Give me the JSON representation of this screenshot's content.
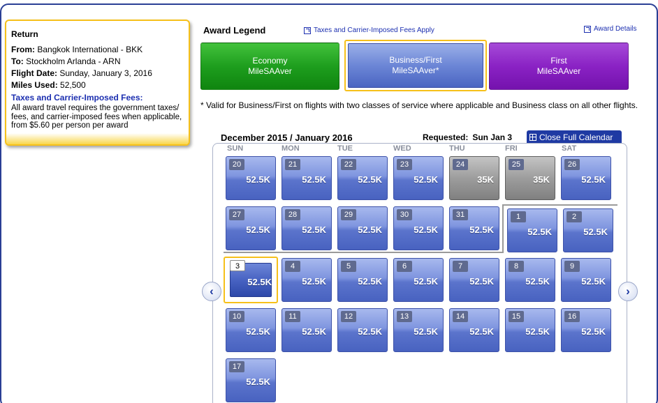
{
  "return_box": {
    "title": "Return",
    "from_label": "From:",
    "from_value": "Bangkok International - BKK",
    "to_label": "To:",
    "to_value": "Stockholm Arlanda - ARN",
    "date_label": "Flight Date:",
    "date_value": "Sunday, January 3, 2016",
    "miles_label": "Miles Used:",
    "miles_value": "52,500",
    "taxes_heading": "Taxes and Carrier-Imposed Fees:",
    "taxes_body": "All award travel requires the government taxes/ fees, and carrier-imposed fees when applicable, from $5.60 per person per award"
  },
  "legend": {
    "title": "Award Legend",
    "taxes_link": "Taxes and Carrier-Imposed Fees Apply",
    "details_link": "Award Details",
    "economy": {
      "line1": "Economy",
      "line2": "MileSAAver"
    },
    "business": {
      "line1": "Business/First",
      "line2": "MileSAAver*"
    },
    "first": {
      "line1": "First",
      "line2": "MileSAAver"
    },
    "colors": {
      "economy": "#1e9e1e",
      "business": "#6c86d6",
      "first": "#8a22c4"
    }
  },
  "note": "* Valid for Business/First on flights with two classes of service where applicable and Business class on all other flights.",
  "calendar": {
    "heading": "December 2015 / January 2016",
    "requested_label": "Requested:",
    "requested_value": "Sun Jan 3",
    "close_label": "Close Full Calendar",
    "days_of_week": [
      "SUN",
      "MON",
      "TUE",
      "WED",
      "THU",
      "FRI",
      "SAT"
    ],
    "weeks": [
      [
        {
          "d": "20",
          "v": "52.5K"
        },
        {
          "d": "21",
          "v": "52.5K"
        },
        {
          "d": "22",
          "v": "52.5K"
        },
        {
          "d": "23",
          "v": "52.5K"
        },
        {
          "d": "24",
          "v": "35K",
          "grey": true
        },
        {
          "d": "25",
          "v": "35K",
          "grey": true
        },
        {
          "d": "26",
          "v": "52.5K"
        }
      ],
      [
        {
          "d": "27",
          "v": "52.5K"
        },
        {
          "d": "28",
          "v": "52.5K"
        },
        {
          "d": "29",
          "v": "52.5K"
        },
        {
          "d": "30",
          "v": "52.5K"
        },
        {
          "d": "31",
          "v": "52.5K"
        },
        {
          "d": "1",
          "v": "52.5K",
          "jan": true
        },
        {
          "d": "2",
          "v": "52.5K",
          "jan": true
        }
      ],
      [
        {
          "d": "3",
          "v": "52.5K",
          "sel": true
        },
        {
          "d": "4",
          "v": "52.5K"
        },
        {
          "d": "5",
          "v": "52.5K"
        },
        {
          "d": "6",
          "v": "52.5K"
        },
        {
          "d": "7",
          "v": "52.5K"
        },
        {
          "d": "8",
          "v": "52.5K"
        },
        {
          "d": "9",
          "v": "52.5K"
        }
      ],
      [
        {
          "d": "10",
          "v": "52.5K"
        },
        {
          "d": "11",
          "v": "52.5K"
        },
        {
          "d": "12",
          "v": "52.5K"
        },
        {
          "d": "13",
          "v": "52.5K"
        },
        {
          "d": "14",
          "v": "52.5K"
        },
        {
          "d": "15",
          "v": "52.5K"
        },
        {
          "d": "16",
          "v": "52.5K"
        }
      ],
      [
        {
          "d": "17",
          "v": "52.5K"
        }
      ]
    ]
  },
  "icons": {
    "prev": "chevron-left-icon",
    "next": "chevron-right-icon"
  }
}
